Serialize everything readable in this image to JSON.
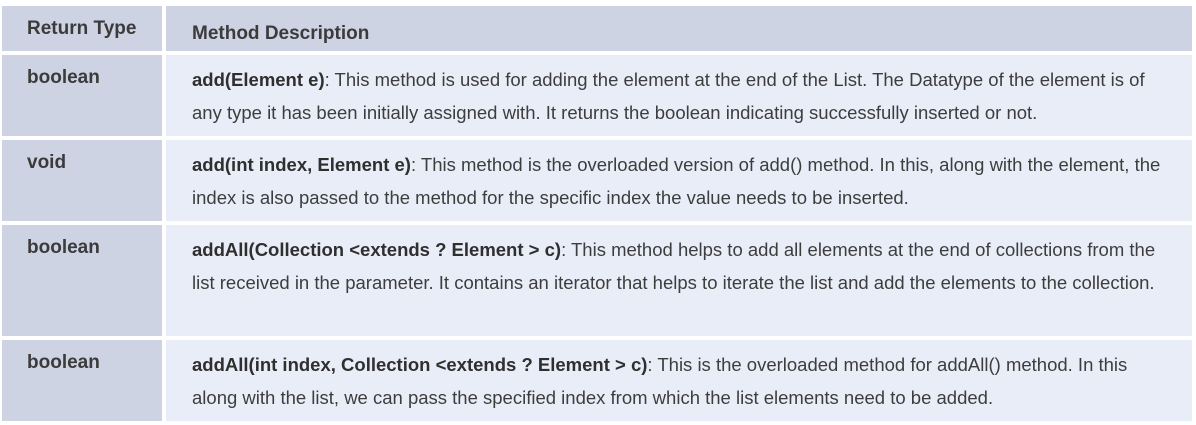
{
  "header": {
    "return_type": "Return Type",
    "method_description": "Method Description"
  },
  "rows": [
    {
      "type": "boolean",
      "method": "add(Element e)",
      "desc": ": This method is used for adding the element at the end of the List. The Datatype of the element is of any type it has been initially assigned with. It returns the boolean indicating successfully inserted or not."
    },
    {
      "type": "void",
      "method": "add(int index, Element e)",
      "desc": ": This method is the overloaded version of add() method. In this, along with the element, the index is also passed to the method for the specific index the value needs to be inserted."
    },
    {
      "type": "boolean",
      "method": "addAll(Collection <extends ? Element > c)",
      "desc": ": This method helps to add all elements at the end of collections from the list received in the parameter. It contains an iterator that helps to iterate the list and add the elements to the collection."
    },
    {
      "type": "boolean",
      "method": "addAll(int index, Collection <extends ? Element > c)",
      "desc": ": This is the overloaded method for addAll() method. In this along with the list, we can pass the specified index from which the list elements need to be added."
    }
  ]
}
